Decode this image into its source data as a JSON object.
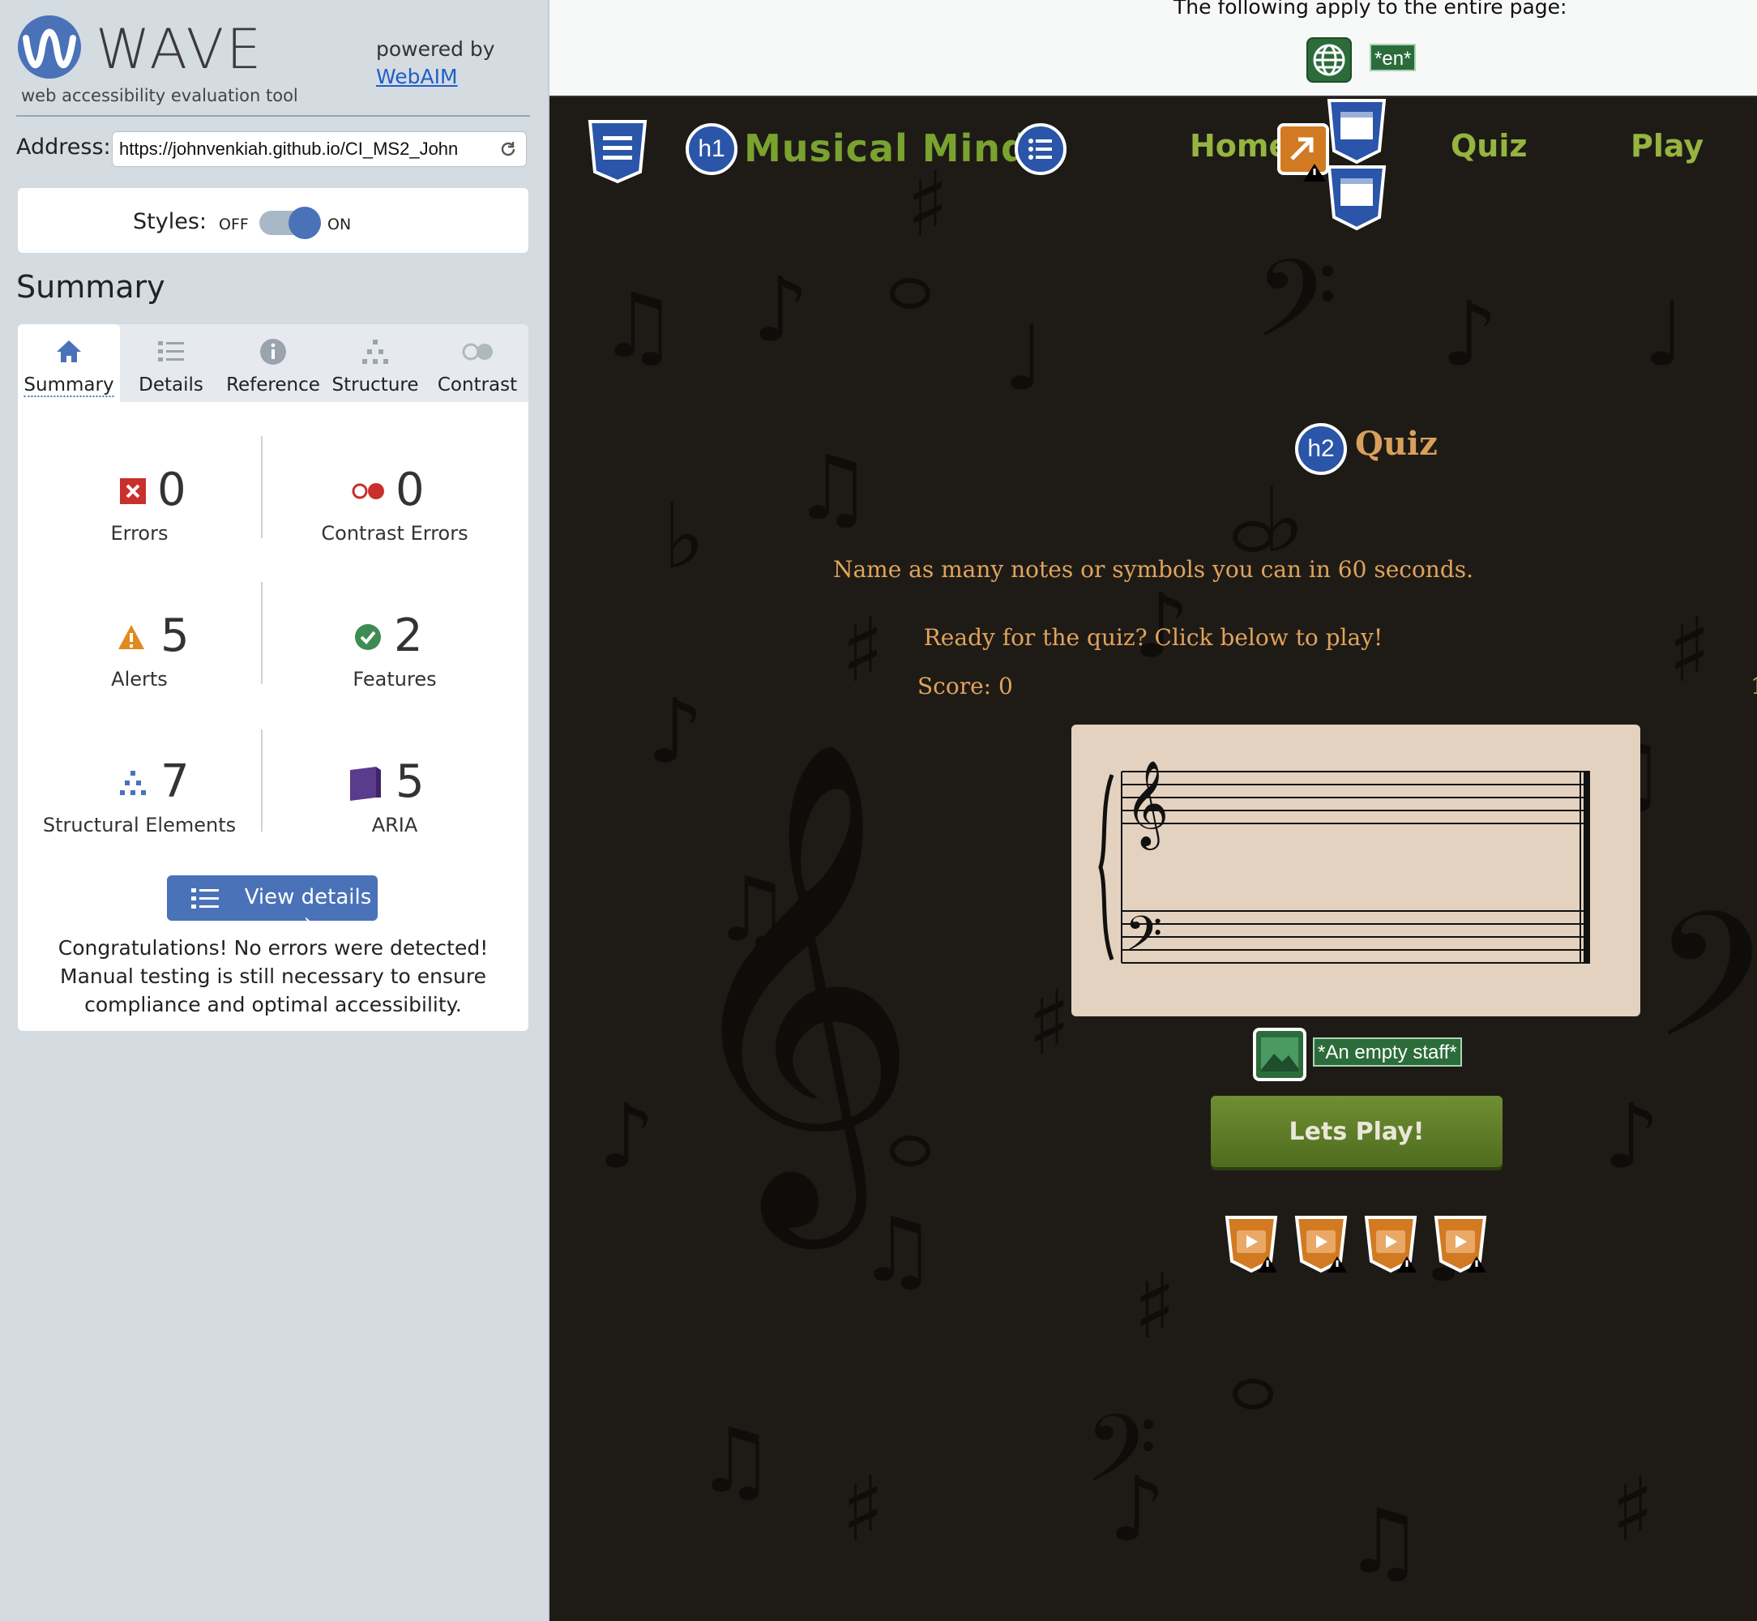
{
  "wave": {
    "logo_text": "WAVE",
    "logo_subtitle": "web accessibility evaluation tool",
    "powered_by": "powered by",
    "webaim_link": "WebAIM",
    "address_label": "Address:",
    "address_value": "https://johnvenkiah.github.io/CI_MS2_John",
    "styles_label": "Styles:",
    "styles_off": "OFF",
    "styles_on": "ON",
    "styles_enabled": true,
    "summary_heading": "Summary",
    "tabs": [
      {
        "label": "Summary",
        "icon": "home-icon",
        "active": true
      },
      {
        "label": "Details",
        "icon": "list-icon"
      },
      {
        "label": "Reference",
        "icon": "info-icon"
      },
      {
        "label": "Structure",
        "icon": "hierarchy-icon"
      },
      {
        "label": "Contrast",
        "icon": "contrast-toggle-icon"
      }
    ],
    "stats": {
      "errors": {
        "count": "0",
        "label": "Errors"
      },
      "contrast_errors": {
        "count": "0",
        "label": "Contrast Errors"
      },
      "alerts": {
        "count": "5",
        "label": "Alerts"
      },
      "features": {
        "count": "2",
        "label": "Features"
      },
      "structural": {
        "count": "7",
        "label": "Structural Elements"
      },
      "aria": {
        "count": "5",
        "label": "ARIA"
      }
    },
    "view_details": "View details ›",
    "congrats": "Congratulations! No errors were detected! Manual testing is still necessary to ensure compliance and optimal accessibility."
  },
  "page": {
    "apply_text": "The following apply to the entire page:",
    "lang_badge": "*en*",
    "h1_badge": "h1",
    "brand": "Musical Minds",
    "nav": {
      "home": "Home",
      "quiz": "Quiz",
      "play": "Play"
    },
    "h2_badge": "h2",
    "quiz_heading": "Quiz",
    "instruction_1": "Name as many notes or symbols you can in 60 seconds.",
    "instruction_2": "Ready for the quiz? Click below to play!",
    "score": "Score: 0",
    "timer_partial": "1",
    "alt_text": "*An empty staff*",
    "play_button": "Lets Play!"
  },
  "colors": {
    "wave_blue": "#4a72b8",
    "wave_sidebar_bg": "#d4dbe1",
    "feature_green": "#2c6c3b",
    "site_bg": "#1e1b17",
    "brand_green": "#7aa22f",
    "text_amber": "#e0a35b",
    "staff_bg": "#e3d2bf"
  }
}
